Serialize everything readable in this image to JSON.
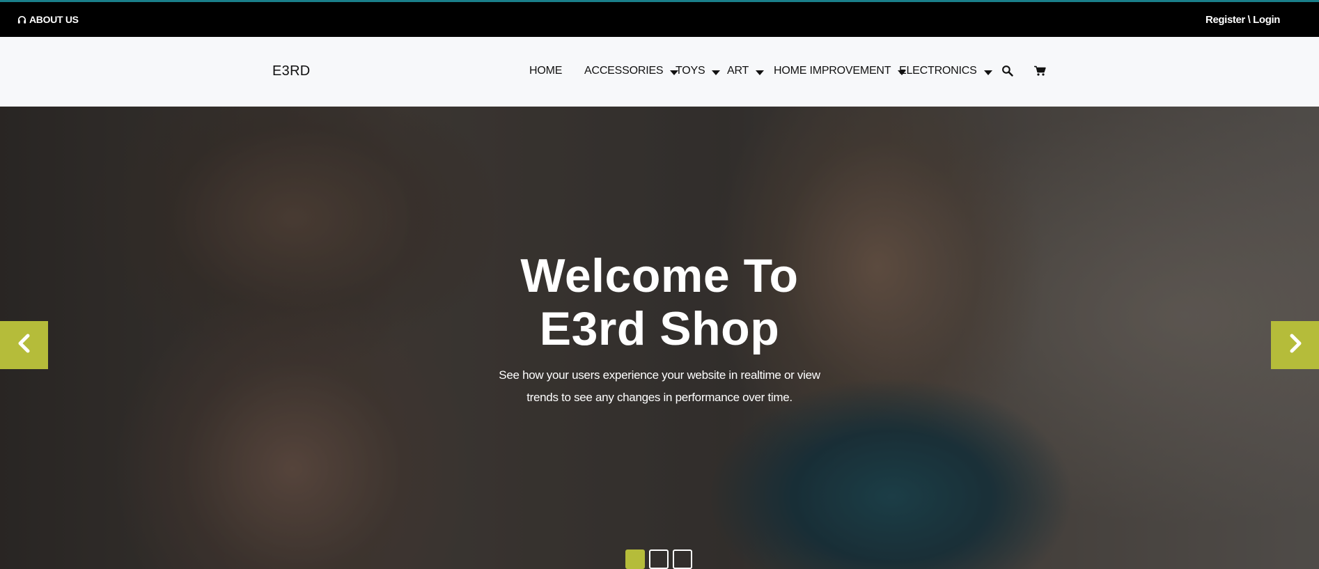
{
  "topbar": {
    "about_label": "ABOUT US",
    "about_icon": "headset-icon",
    "auth_label": "Register \\ Login"
  },
  "navbar": {
    "brand": "E3RD",
    "items": [
      {
        "label": "HOME",
        "dropdown": false
      },
      {
        "label": "ACCESSORIES",
        "dropdown": true
      },
      {
        "label": "TOYS",
        "dropdown": true
      },
      {
        "label": "ART",
        "dropdown": true
      },
      {
        "label": "HOME IMPROVEMENT",
        "dropdown": true
      },
      {
        "label": "ELECTRONICS",
        "dropdown": true
      }
    ],
    "icons": [
      "search-icon",
      "cart-icon"
    ]
  },
  "hero": {
    "title_line1": "Welcome To",
    "title_line2": "E3rd Shop",
    "subtitle_line1": "See how your users experience your website in realtime or view",
    "subtitle_line2": "trends to see any changes in performance over time.",
    "prev_icon": "chevron-left-icon",
    "next_icon": "chevron-right-icon",
    "slides_total": 3,
    "active_slide": 1
  },
  "colors": {
    "accent": "#b5bc3a",
    "topbar_bg": "#000000",
    "topbar_border": "#1a7f8a",
    "navbar_bg": "#f7f8fa"
  }
}
